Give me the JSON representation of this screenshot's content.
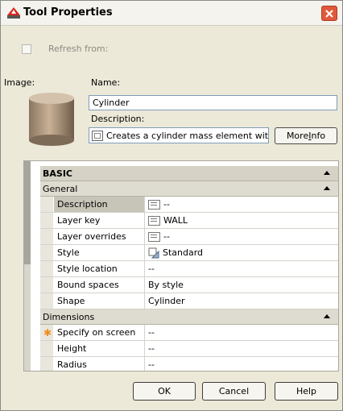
{
  "window": {
    "title": "Tool Properties"
  },
  "refresh": {
    "label": "Refresh from:",
    "checked": false
  },
  "labels": {
    "image": "Image:",
    "name": "Name:",
    "description": "Description:"
  },
  "fields": {
    "name_value": "Cylinder",
    "description_value": "Creates a cylinder mass element with"
  },
  "more_info": {
    "pre": "More ",
    "underline": "I",
    "post": "nfo"
  },
  "grid": {
    "basic_label": "BASIC",
    "general_label": "General",
    "dimensions_label": "Dimensions",
    "general_rows": [
      {
        "name": "Description",
        "value": "--",
        "icon": "list-icon"
      },
      {
        "name": "Layer key",
        "value": "WALL",
        "icon": "list-icon"
      },
      {
        "name": "Layer overrides",
        "value": "--",
        "icon": "list-icon"
      },
      {
        "name": "Style",
        "value": "Standard",
        "icon": "style-icon"
      },
      {
        "name": "Style location",
        "value": "--"
      },
      {
        "name": "Bound spaces",
        "value": "By style"
      },
      {
        "name": "Shape",
        "value": "Cylinder"
      }
    ],
    "dimension_rows": [
      {
        "name": "Specify on screen",
        "value": "--",
        "marker": "asterisk-icon"
      },
      {
        "name": "Height",
        "value": "--"
      },
      {
        "name": "Radius",
        "value": "--"
      }
    ]
  },
  "buttons": {
    "ok": "OK",
    "cancel": "Cancel",
    "help": "Help"
  }
}
